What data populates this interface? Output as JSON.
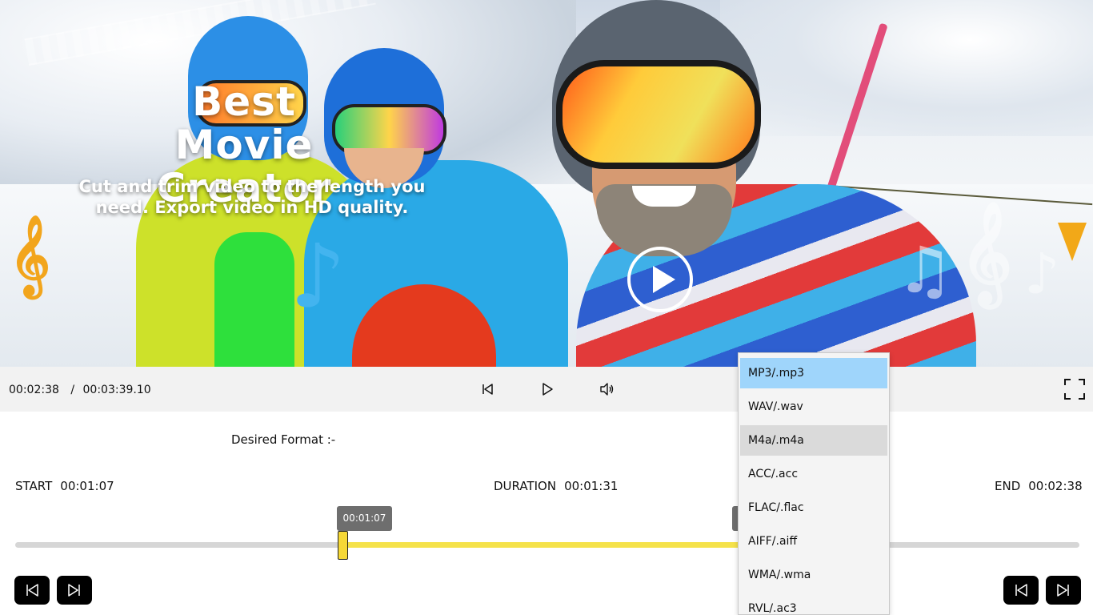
{
  "hero": {
    "title": "Best Movie Creator",
    "subtitle": "Cut and trim video to the length you need. Export video in HD quality."
  },
  "player": {
    "current_time": "00:02:38",
    "separator": "/",
    "total_time": "00:03:39.10"
  },
  "editor": {
    "desired_format_label": "Desired Format :-",
    "start_label": "START",
    "start_value": "00:01:07",
    "duration_label": "DURATION",
    "duration_value": "00:01:31",
    "end_label": "END",
    "end_value": "00:02:38",
    "start_handle_tooltip": "00:01:07",
    "selection": {
      "start_fraction": 0.306,
      "end_fraction": 0.72
    }
  },
  "format_dropdown": {
    "options": [
      "MP3/.mp3",
      "WAV/.wav",
      "M4a/.m4a",
      "ACC/.acc",
      "FLAC/.flac",
      "AIFF/.aiff",
      "WMA/.wma",
      "RVL/.ac3"
    ],
    "selected_index": 0,
    "hover_index": 2
  },
  "colors": {
    "selected_option": "#9fd5fb",
    "hover_option": "#dadada",
    "selection_track": "#f5e24a",
    "handle": "#f6d836",
    "tooltip": "#6e6e6e",
    "step_button": "#000000"
  },
  "icons": {
    "prev": "previous-track-icon",
    "play": "play-icon",
    "volume": "volume-icon",
    "fullscreen": "fullscreen-icon",
    "step_back": "step-back-icon",
    "step_forward": "step-forward-icon"
  }
}
